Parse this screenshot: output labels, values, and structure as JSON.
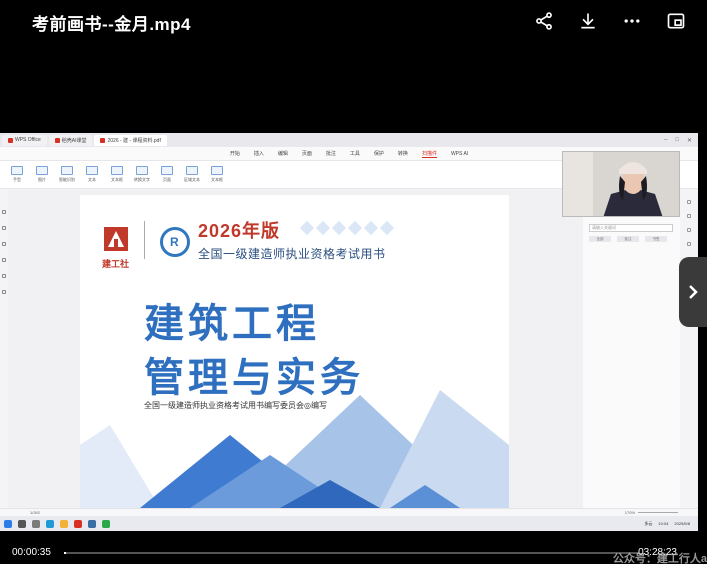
{
  "player": {
    "title": "考前画书--金月.mp4",
    "current_time": "00:00:35",
    "duration": "03:28:23",
    "progress": 0.0028
  },
  "browser": {
    "tabs": [
      {
        "label": "WPS Office",
        "active": false
      },
      {
        "label": "稻壳AI课堂",
        "active": false
      },
      {
        "label": "2026 - 建 - 课程资料.pdf",
        "active": true
      }
    ]
  },
  "menu": {
    "items": [
      "开始",
      "插入",
      "编辑",
      "页面",
      "批注",
      "工具",
      "保护",
      "转换",
      "扫描件",
      "WPS AI"
    ],
    "active_index": 8
  },
  "toolbar": {
    "tools": [
      "手型",
      "图片",
      "智能识别",
      "文本",
      "文本框",
      "转换文字",
      "页面",
      "区域文本",
      "文本框"
    ]
  },
  "document": {
    "logo_text": "建工社",
    "edition": "2026年版",
    "subtitle": "全国一级建造师执业资格考试用书",
    "title_line1": "建筑工程",
    "title_line2": "管理与实务",
    "committee": "全国一级建造师执业资格考试用书编写委员会◎编写"
  },
  "right_panel": {
    "header": "文件目录",
    "search_placeholder": "请输入关键词",
    "buttons": [
      "全部",
      "批注",
      "书签"
    ]
  },
  "status": {
    "page": "1/392",
    "zoom": "170%"
  },
  "taskbar": {
    "weather": "多云",
    "time": "10:04",
    "date": "2025/5/8"
  },
  "watermark": "公众号：建工行人a",
  "colors": {
    "accent_red": "#d93025",
    "title_blue": "#2f6fbf",
    "edition_red": "#c0392b"
  }
}
